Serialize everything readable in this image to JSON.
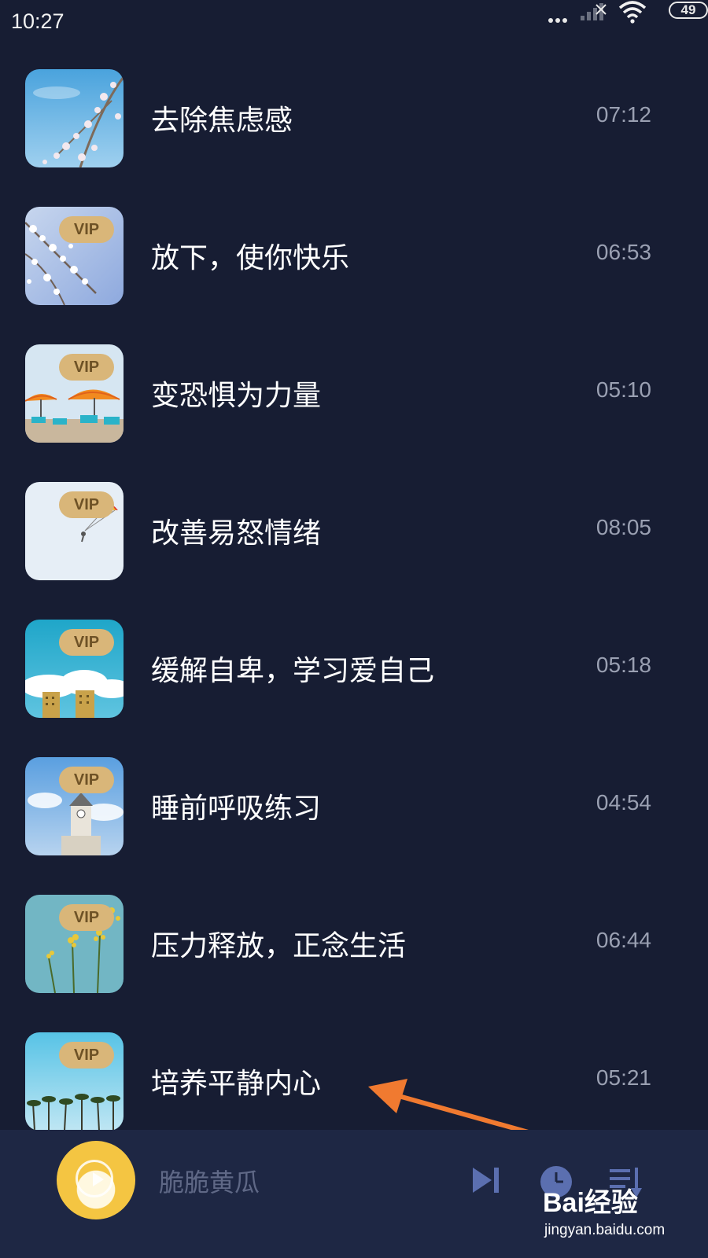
{
  "status_bar": {
    "time": "10:27",
    "battery": "49"
  },
  "tracks": [
    {
      "title": "去除焦虑感",
      "duration": "07:12",
      "vip": false,
      "thumb": "sky-blossom"
    },
    {
      "title": "放下，使你快乐",
      "duration": "06:53",
      "vip": true,
      "vip_label": "VIP",
      "thumb": "blossom-branch"
    },
    {
      "title": "变恐惧为力量",
      "duration": "05:10",
      "vip": true,
      "vip_label": "VIP",
      "thumb": "beach-umbrellas"
    },
    {
      "title": "改善易怒情绪",
      "duration": "08:05",
      "vip": true,
      "vip_label": "VIP",
      "thumb": "parasail"
    },
    {
      "title": "缓解自卑，学习爱自己",
      "duration": "05:18",
      "vip": true,
      "vip_label": "VIP",
      "thumb": "clouds-buildings"
    },
    {
      "title": "睡前呼吸练习",
      "duration": "04:54",
      "vip": true,
      "vip_label": "VIP",
      "thumb": "clock-tower"
    },
    {
      "title": "压力释放，正念生活",
      "duration": "06:44",
      "vip": true,
      "vip_label": "VIP",
      "thumb": "wildflowers"
    },
    {
      "title": "培养平静内心",
      "duration": "05:21",
      "vip": true,
      "vip_label": "VIP",
      "thumb": "palm-trees"
    }
  ],
  "player": {
    "now_playing": "脆脆黄瓜"
  },
  "watermark": {
    "brand": "Bai经验",
    "url": "jingyan.baidu.com"
  },
  "colors": {
    "background": "#171d33",
    "player_bar": "#1e2744",
    "vip_badge": "#d9b679",
    "arrow": "#f07a30"
  }
}
